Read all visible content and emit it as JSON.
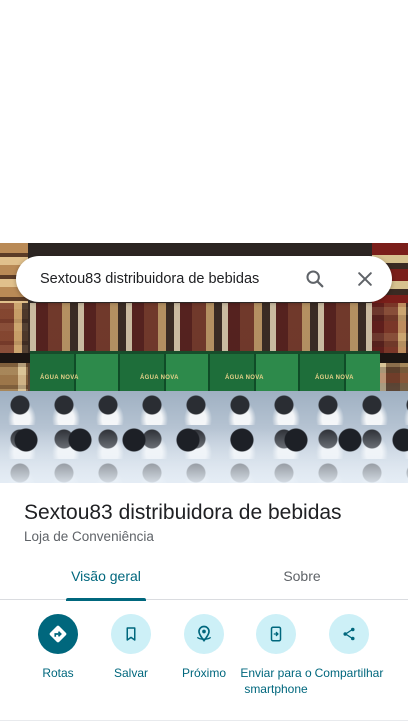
{
  "search": {
    "query": "Sextou83 distribuidora de bebidas"
  },
  "photo": {
    "crate_labels": [
      "ÁGUA NOVA",
      "ÁGUA NOVA",
      "ÁGUA NOVA",
      "ÁGUA NOVA"
    ]
  },
  "place": {
    "name": "Sextou83 distribuidora de bebidas",
    "category": "Loja de Conveniência"
  },
  "tabs": [
    {
      "label": "Visão geral",
      "active": true
    },
    {
      "label": "Sobre",
      "active": false
    }
  ],
  "actions": [
    {
      "label": "Rotas",
      "icon": "directions-icon"
    },
    {
      "label": "Salvar",
      "icon": "bookmark-icon"
    },
    {
      "label": "Próximo",
      "icon": "nearby-icon"
    },
    {
      "label": "Enviar para o smartphone",
      "icon": "send-to-phone-icon"
    },
    {
      "label": "Compartilhar",
      "icon": "share-icon"
    }
  ],
  "colors": {
    "accent": "#00677d",
    "action_bg": "#cdf0f7",
    "title_text": "#202124",
    "secondary_text": "#5f6368"
  }
}
